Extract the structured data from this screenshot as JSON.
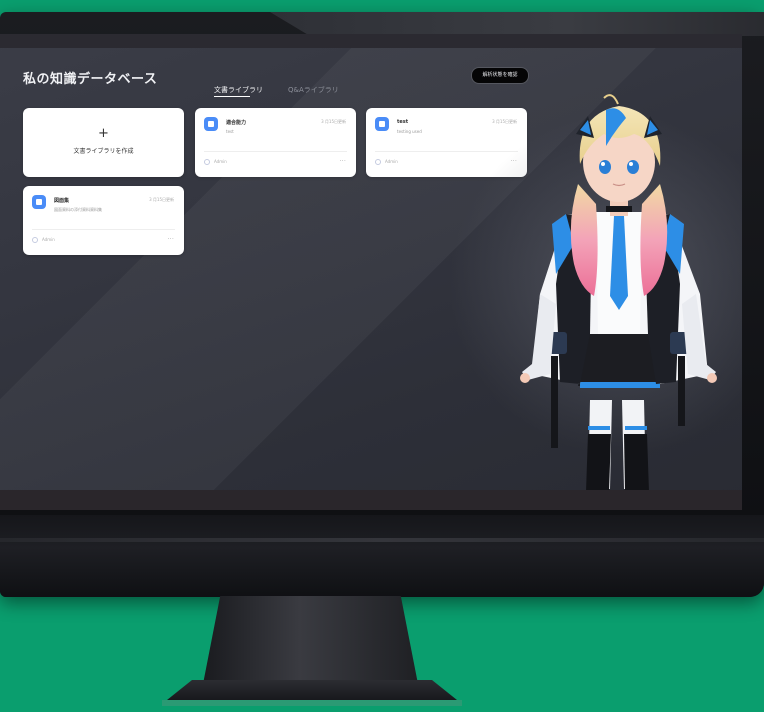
{
  "colors": {
    "background": "#0a9e6e",
    "screen": "#343640",
    "accent_blue": "#4a8cf7",
    "card": "#ffffff"
  },
  "page": {
    "title": "私の知識データベース"
  },
  "tabs": [
    {
      "label": "文書ライブラリ",
      "active": true
    },
    {
      "label": "Q&Aライブラリ",
      "active": false
    }
  ],
  "header_button": {
    "label": "解析状態を確認"
  },
  "create_card": {
    "plus": "+",
    "label": "文書ライブラリを作成"
  },
  "libraries": [
    {
      "name": "適合能力",
      "desc": "test",
      "date": "3 月15日更新",
      "owner": "Admin",
      "more": "···"
    },
    {
      "name": "test",
      "desc": "testing used",
      "date": "3 月15日更新",
      "owner": "Admin",
      "more": "···"
    },
    {
      "name": "図面集",
      "desc": "図面資料の添付資料資料集",
      "date": "3 月15日更新",
      "owner": "Admin",
      "more": "···"
    }
  ],
  "icons": {
    "library": "document-library-icon",
    "owner": "user-icon",
    "more": "more-icon"
  }
}
